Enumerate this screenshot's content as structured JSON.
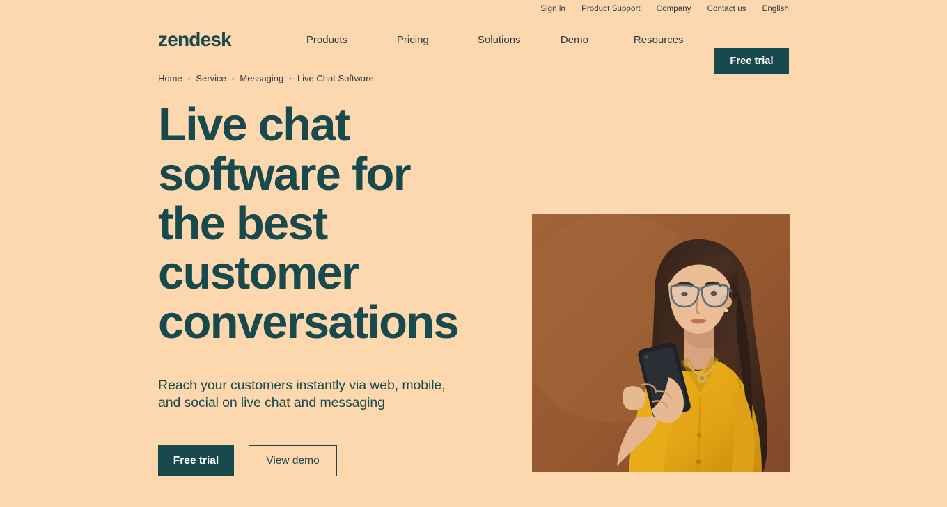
{
  "theme": {
    "page_background": "#FDD7AE",
    "accent_dark": "#17494D",
    "text_primary": "#2F3941",
    "image_background": "#9A5E33",
    "blouse_color": "#E5A81C"
  },
  "utility_bar": {
    "links": [
      {
        "label": "Sign in",
        "name": "sign-in"
      },
      {
        "label": "Product Support",
        "name": "product-support"
      },
      {
        "label": "Company",
        "name": "company"
      },
      {
        "label": "Contact us",
        "name": "contact-us"
      },
      {
        "label": "English",
        "name": "language"
      }
    ]
  },
  "header": {
    "brand": "zendesk",
    "nav": [
      {
        "label": "Products"
      },
      {
        "label": "Pricing"
      },
      {
        "label": "Solutions"
      },
      {
        "label": "Demo"
      },
      {
        "label": "Resources"
      }
    ],
    "cta_label": "Free trial"
  },
  "breadcrumb": {
    "items": [
      {
        "label": "Home",
        "is_link": true
      },
      {
        "label": "Service",
        "is_link": true
      },
      {
        "label": "Messaging",
        "is_link": true
      },
      {
        "label": "Live Chat Software",
        "is_link": false
      }
    ],
    "separator": "›"
  },
  "hero": {
    "title": "Live chat software for the best customer conversations",
    "subtitle": "Reach your customers instantly via web, mobile, and social on live chat and messaging",
    "primary_cta": "Free trial",
    "secondary_cta": "View demo",
    "image_alt": "Woman with glasses in a yellow blouse looking at a smartphone against a brown backdrop"
  }
}
